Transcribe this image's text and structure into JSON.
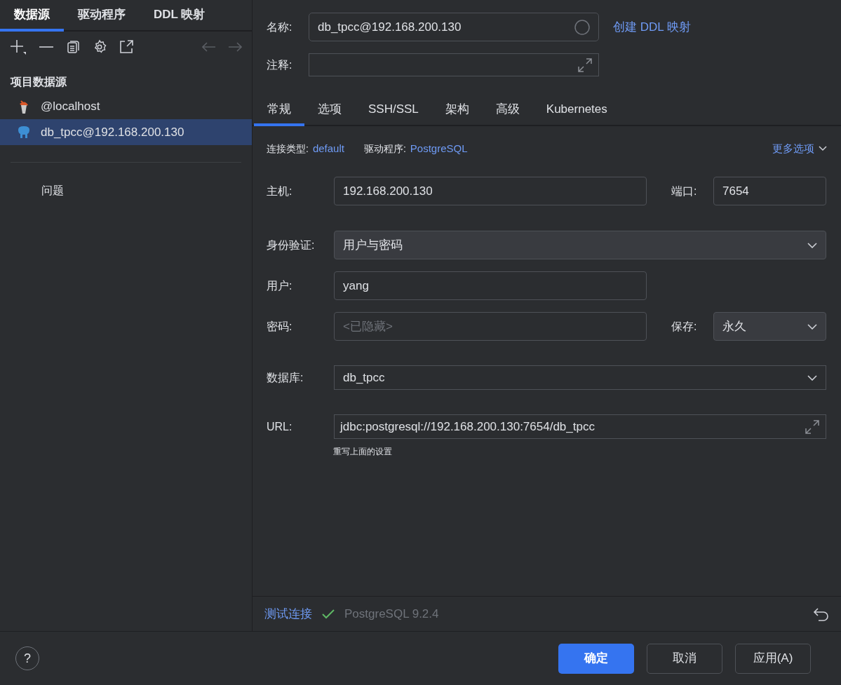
{
  "sidebar": {
    "tabs": [
      {
        "label": "数据源",
        "selected": true
      },
      {
        "label": "驱动程序",
        "selected": false
      },
      {
        "label": "DDL 映射",
        "selected": false
      }
    ],
    "section_title": "项目数据源",
    "datasources": [
      {
        "name": "@localhost",
        "kind": "mssql",
        "selected": false
      },
      {
        "name": "db_tpcc@192.168.200.130",
        "kind": "postgres",
        "selected": true
      }
    ],
    "problems": "问题"
  },
  "name_field": {
    "label": "名称:",
    "value": "db_tpcc@192.168.200.130"
  },
  "create_ddl_link": "创建 DDL 映射",
  "comment_field": {
    "label": "注释:"
  },
  "tabs": [
    {
      "label": "常规",
      "selected": true
    },
    {
      "label": "选项",
      "selected": false
    },
    {
      "label": "SSH/SSL",
      "selected": false
    },
    {
      "label": "架构",
      "selected": false
    },
    {
      "label": "高级",
      "selected": false
    },
    {
      "label": "Kubernetes",
      "selected": false
    }
  ],
  "info": {
    "connection_type_label": "连接类型:",
    "connection_type": "default",
    "driver_label": "驱动程序:",
    "driver": "PostgreSQL",
    "more_options": "更多选项"
  },
  "form": {
    "host": {
      "label": "主机:",
      "value": "192.168.200.130"
    },
    "port": {
      "label": "端口:",
      "value": "7654"
    },
    "auth": {
      "label": "身份验证:",
      "value": "用户与密码"
    },
    "user": {
      "label": "用户:",
      "value": "yang"
    },
    "password": {
      "label": "密码:",
      "placeholder": "<已隐藏>"
    },
    "save": {
      "label": "保存:",
      "value": "永久"
    },
    "database": {
      "label": "数据库:",
      "value": "db_tpcc"
    },
    "url": {
      "label": "URL:",
      "value": "jdbc:postgresql://192.168.200.130:7654/db_tpcc",
      "hint": "重写上面的设置"
    }
  },
  "test": {
    "link": "测试连接",
    "status": "PostgreSQL 9.2.4",
    "success": true
  },
  "help": "?",
  "buttons": [
    {
      "label": "确定",
      "primary": true
    },
    {
      "label": "取消",
      "primary": false
    },
    {
      "label": "应用(A)",
      "primary": false
    }
  ]
}
